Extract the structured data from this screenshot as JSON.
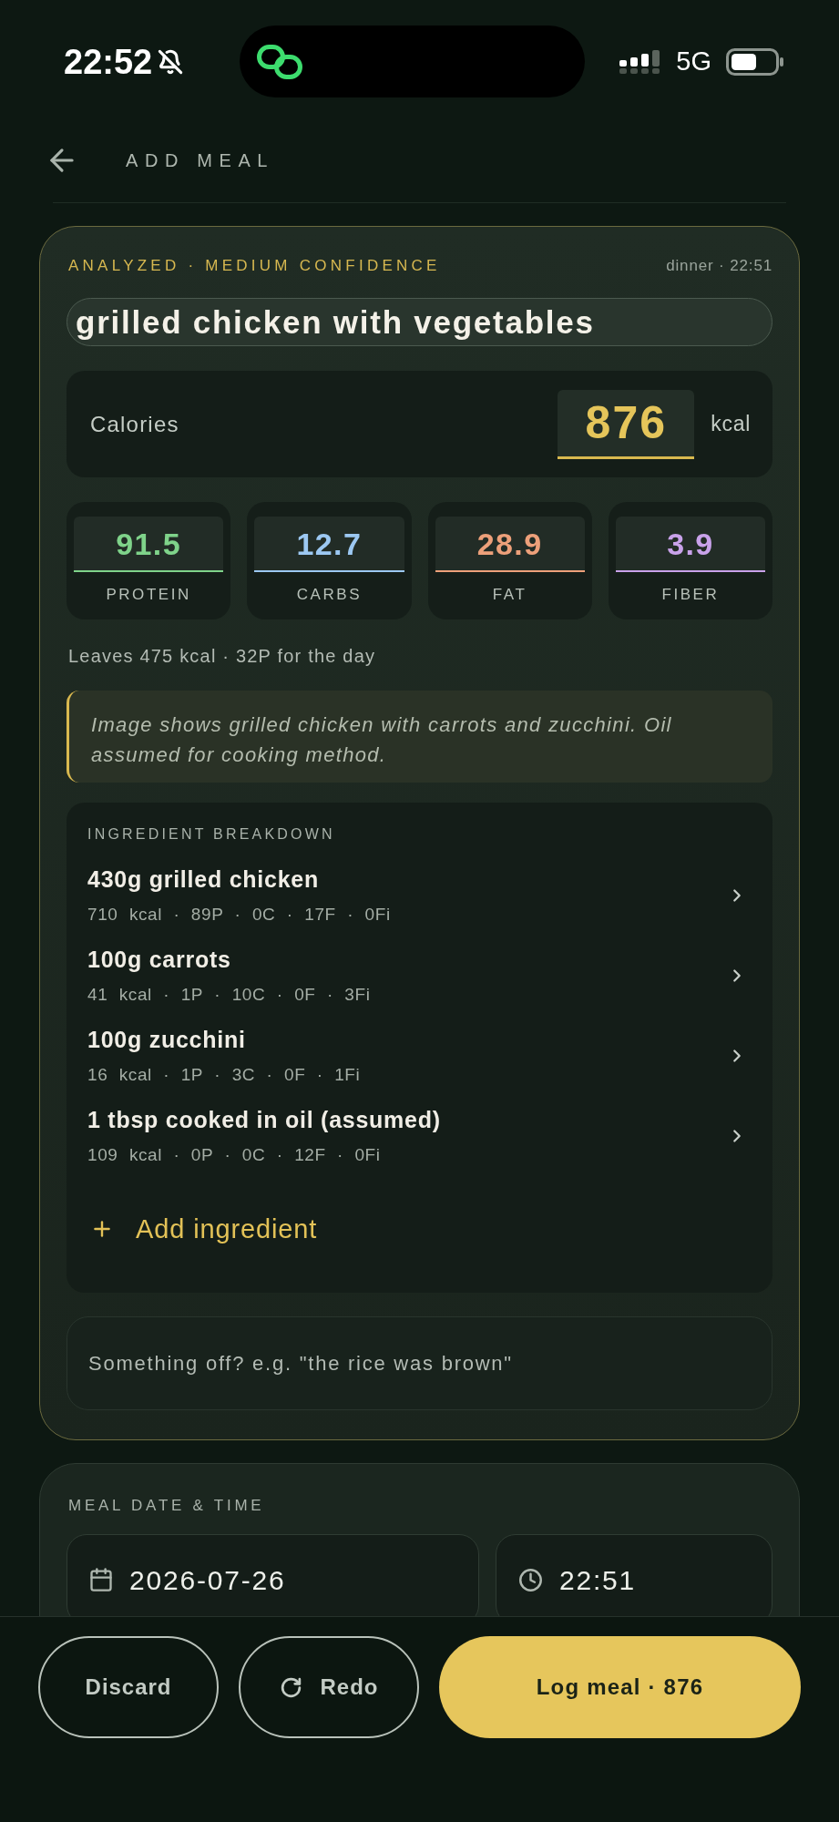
{
  "status_bar": {
    "time": "22:52",
    "network": "5G"
  },
  "header": {
    "title": "ADD MEAL"
  },
  "analysis_card": {
    "status": "ANALYZED · MEDIUM CONFIDENCE",
    "meta": "dinner · 22:51",
    "meal_name": "grilled chicken with vegetables",
    "calories": {
      "label": "Calories",
      "value": "876",
      "unit": "kcal"
    },
    "macros": [
      {
        "value": "91.5",
        "label": "PROTEIN",
        "color": "#7fd38a"
      },
      {
        "value": "12.7",
        "label": "CARBS",
        "color": "#9cc8f2"
      },
      {
        "value": "28.9",
        "label": "FAT",
        "color": "#eda07a"
      },
      {
        "value": "3.9",
        "label": "FIBER",
        "color": "#c9a2ea"
      }
    ],
    "remaining": "Leaves 475 kcal · 32P for the day",
    "note": "Image shows grilled chicken with carrots and zucchini. Oil assumed for cooking method.",
    "ingredients": {
      "title": "INGREDIENT BREAKDOWN",
      "items": [
        {
          "name": "430g grilled chicken",
          "macros": "710 kcal · 89P · 0C · 17F · 0Fi"
        },
        {
          "name": "100g carrots",
          "macros": "41 kcal · 1P · 10C · 0F · 3Fi"
        },
        {
          "name": "100g zucchini",
          "macros": "16 kcal · 1P · 3C · 0F · 1Fi"
        },
        {
          "name": "1 tbsp cooked in oil (assumed)",
          "macros": "109 kcal · 0P · 0C · 12F · 0Fi"
        }
      ],
      "add_label": "Add ingredient"
    },
    "feedback": {
      "placeholder": "Something off? e.g. \"the rice was brown\""
    }
  },
  "datetime_card": {
    "title": "MEAL DATE & TIME",
    "date": "2026-07-26",
    "time": "22:51"
  },
  "actions": [
    {
      "kind": "outline",
      "label": "Discard"
    },
    {
      "kind": "redo",
      "label": "Redo"
    },
    {
      "kind": "primary",
      "label": "Log meal · 876"
    }
  ]
}
